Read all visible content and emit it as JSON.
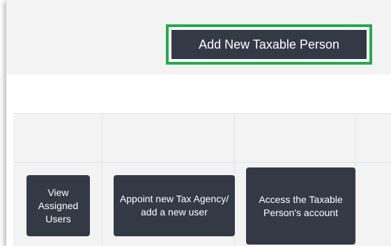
{
  "header": {
    "add_button_label": "Add New Taxable Person",
    "highlight_color": "#1fad4b"
  },
  "actions": {
    "view_label": "View Assigned Users",
    "appoint_label": "Appoint new Tax Agency/ add a new user",
    "access_label": "Access the Taxable Person's account"
  },
  "colors": {
    "button_bg": "#343a45",
    "header_bg": "#f3f3f4"
  }
}
